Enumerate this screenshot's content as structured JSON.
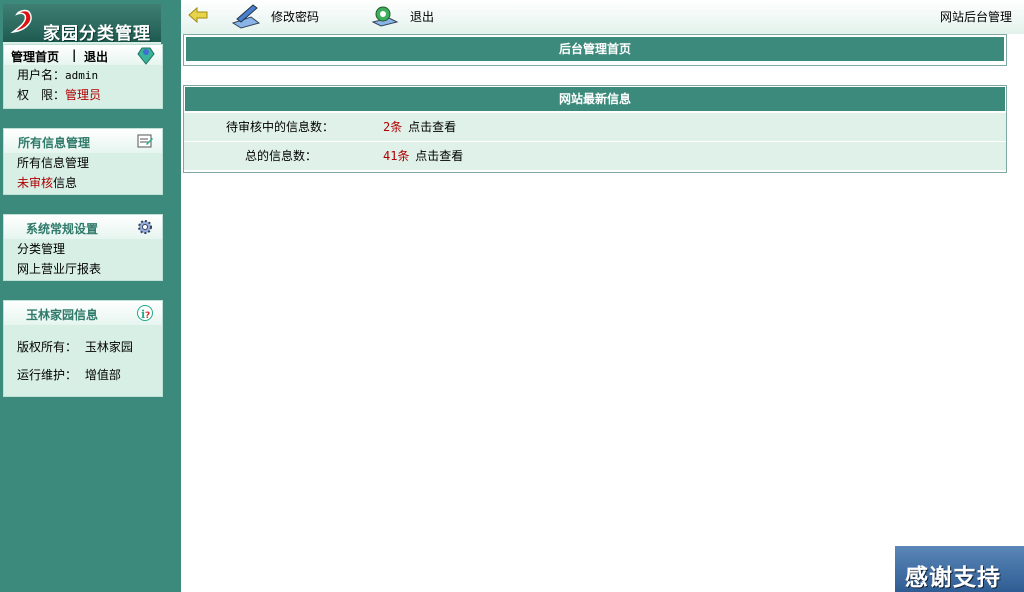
{
  "sidebar": {
    "logo_title": "家园分类管理",
    "user_panel": {
      "home_link": "管理首页",
      "separator": "|",
      "logout_link": "退出",
      "username_label": "用户名：",
      "username_value": "admin",
      "role_label": "权　限：",
      "role_value": "管理员"
    },
    "info_panel": {
      "title": "所有信息管理",
      "items": [
        "所有信息管理"
      ],
      "unreviewed_prefix": "未审核",
      "unreviewed_suffix": "信息"
    },
    "settings_panel": {
      "title": "系统常规设置",
      "items": [
        "分类管理",
        "网上营业厅报表"
      ]
    },
    "about_panel": {
      "title": "玉林家园信息",
      "copyright_label": "版权所有：",
      "copyright_value": "玉林家园",
      "maintain_label": "运行维护：",
      "maintain_value": "增值部"
    }
  },
  "topbar": {
    "change_password": "修改密码",
    "logout": "退出",
    "site_title": "网站后台管理"
  },
  "main": {
    "home_title": "后台管理首页",
    "latest_title": "网站最新信息",
    "rows": [
      {
        "label": "待审核中的信息数：",
        "count": "2条",
        "link": "点击查看"
      },
      {
        "label": "总的信息数：",
        "count": "41条",
        "link": "点击查看"
      }
    ]
  },
  "badge": {
    "text": "感谢支持"
  },
  "colors": {
    "sidebar": "#3b8a7b",
    "panel": "#d8efe6",
    "accent_red": "#b00000"
  }
}
